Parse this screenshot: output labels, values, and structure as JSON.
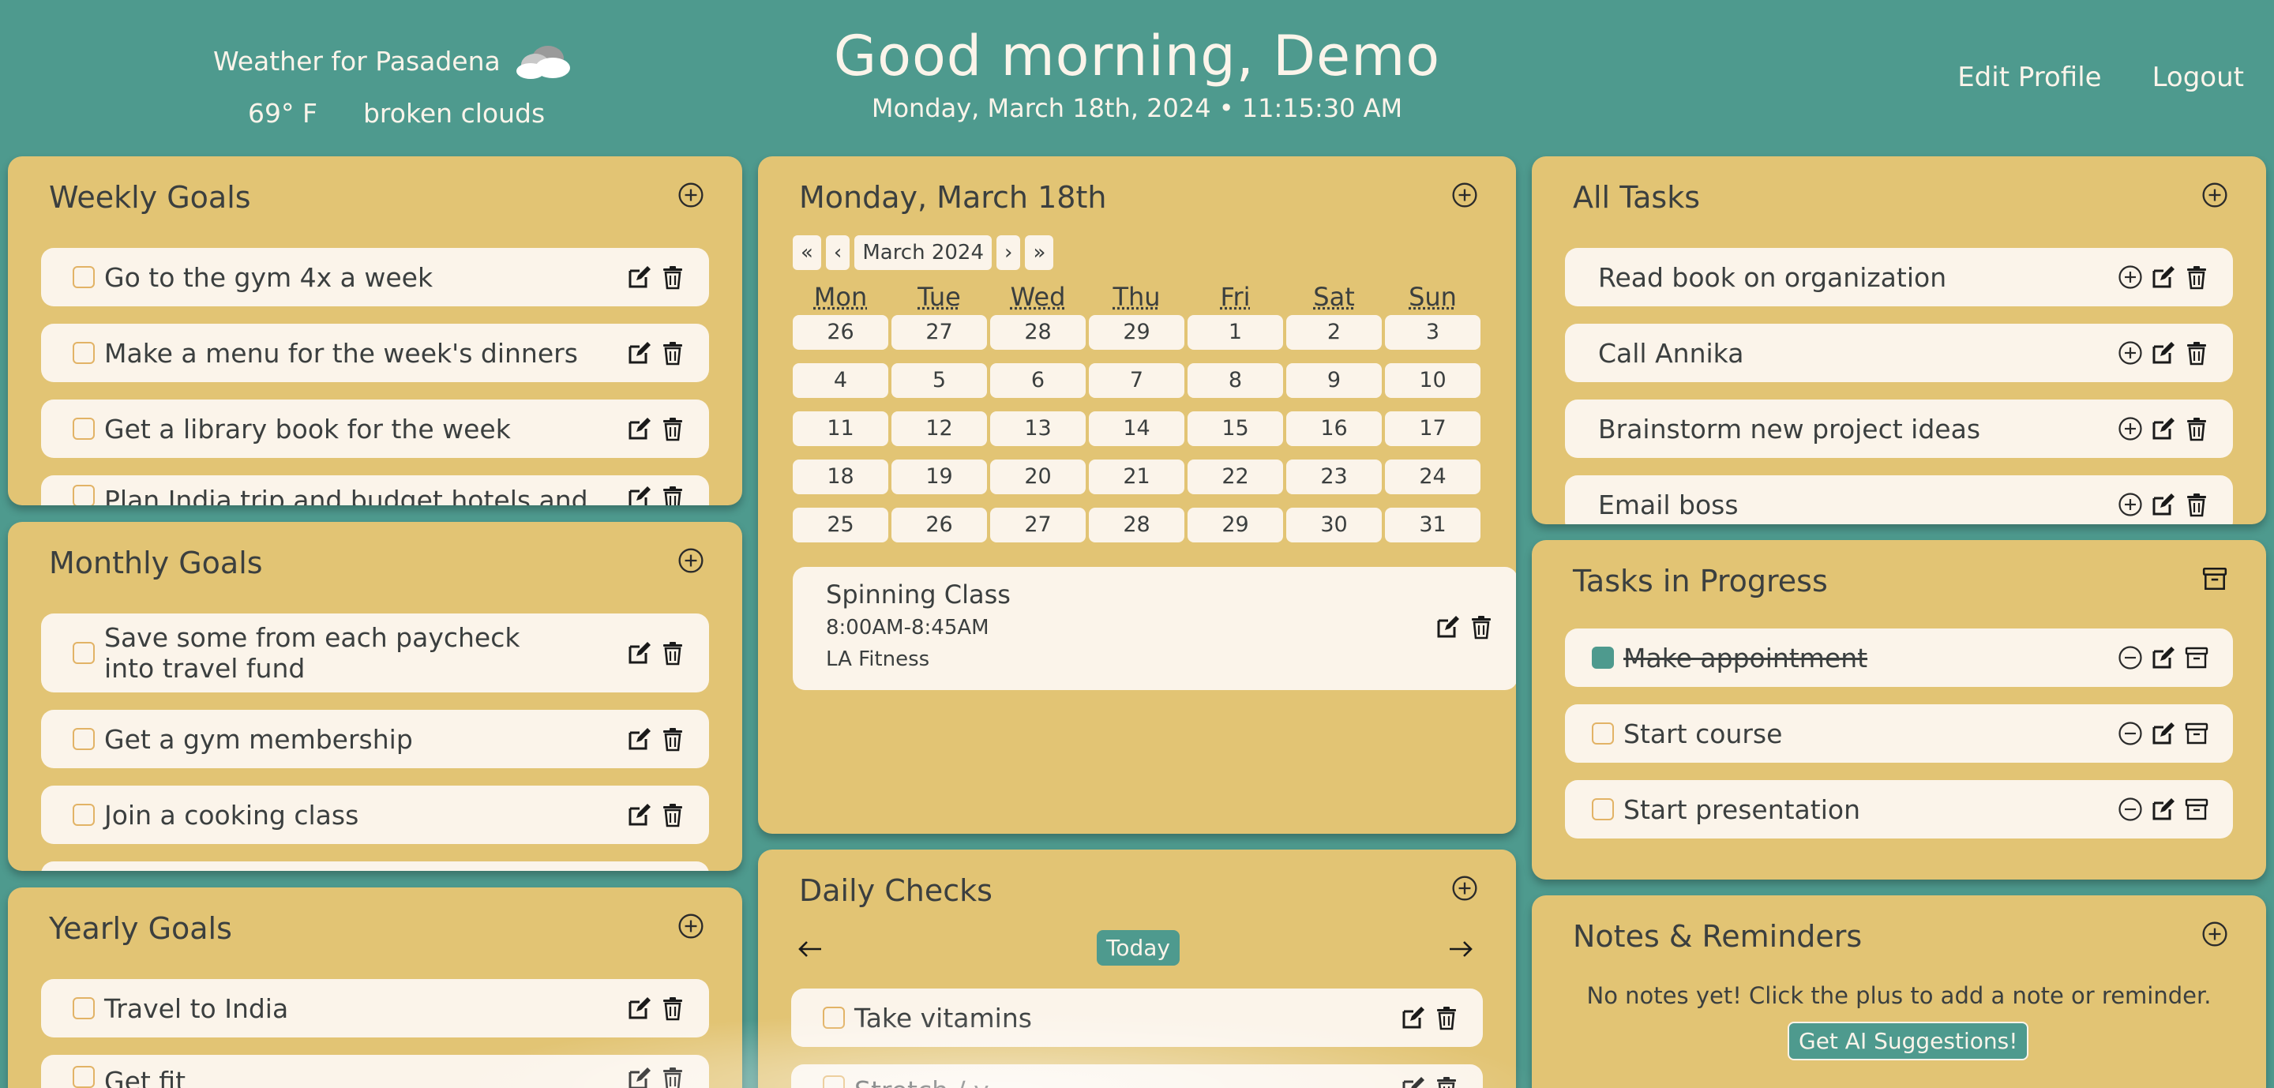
{
  "weather": {
    "title": "Weather for Pasadena",
    "temp": "69° F",
    "desc": "broken clouds",
    "icon": "cloud-icon"
  },
  "header": {
    "greeting": "Good morning, Demo",
    "datetime": "Monday, March 18th, 2024 • 11:15:30 AM"
  },
  "nav": {
    "edit_profile": "Edit Profile",
    "logout": "Logout"
  },
  "colors": {
    "background": "#4e9a8e",
    "panel": "#e2c474",
    "card": "#fbf4ea",
    "accent": "#4e9a8e",
    "checkbox_border": "#e2b366"
  },
  "weekly": {
    "title": "Weekly Goals",
    "items": [
      "Go to the gym 4x a week",
      "Make a menu for the week's dinners",
      "Get a library book for the week",
      "Plan India trip and budget hotels and"
    ]
  },
  "monthly": {
    "title": "Monthly Goals",
    "items": [
      "Save some from each paycheck into travel fund",
      "Get a gym membership",
      "Join a cooking class"
    ]
  },
  "yearly": {
    "title": "Yearly Goals",
    "items": [
      "Travel to India",
      "Get fit"
    ]
  },
  "calendar": {
    "title": "Monday, March 18th",
    "nav": {
      "first": "«",
      "prev": "‹",
      "month": "March 2024",
      "next": "›",
      "last": "»"
    },
    "weekdays": [
      "Mon",
      "Tue",
      "Wed",
      "Thu",
      "Fri",
      "Sat",
      "Sun"
    ],
    "days": [
      "26",
      "27",
      "28",
      "29",
      "1",
      "2",
      "3",
      "4",
      "5",
      "6",
      "7",
      "8",
      "9",
      "10",
      "11",
      "12",
      "13",
      "14",
      "15",
      "16",
      "17",
      "18",
      "19",
      "20",
      "21",
      "22",
      "23",
      "24",
      "25",
      "26",
      "27",
      "28",
      "29",
      "30",
      "31"
    ],
    "event": {
      "name": "Spinning Class",
      "time": "8:00AM-8:45AM",
      "location": "LA Fitness"
    }
  },
  "daily": {
    "title": "Daily Checks",
    "today": "Today",
    "items": [
      "Take vitamins",
      "Stretch / y"
    ]
  },
  "alltasks": {
    "title": "All Tasks",
    "items": [
      "Read book on organization",
      "Call Annika",
      "Brainstorm new project ideas",
      "Email boss"
    ]
  },
  "inprogress": {
    "title": "Tasks in Progress",
    "items": [
      {
        "label": "Make appointment",
        "done": true
      },
      {
        "label": "Start course",
        "done": false
      },
      {
        "label": "Start presentation",
        "done": false
      }
    ]
  },
  "notes": {
    "title": "Notes & Reminders",
    "empty": "No notes yet! Click the plus to add a note or reminder.",
    "ai": "Get AI Suggestions!"
  }
}
